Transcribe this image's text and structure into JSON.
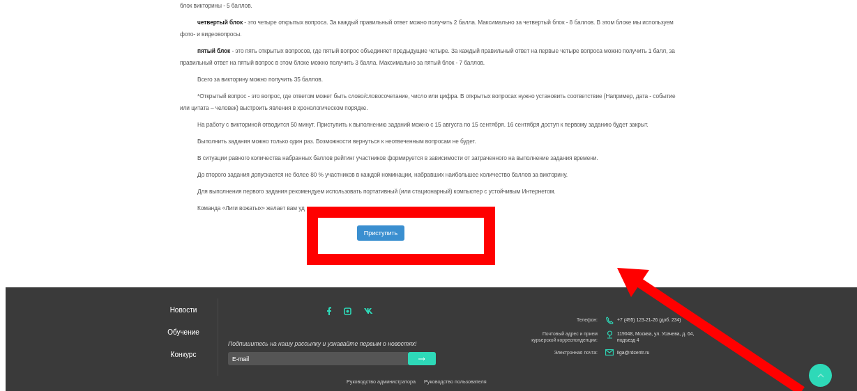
{
  "content": {
    "paragraphs": [
      {
        "text": "блок викторины - 5 баллов.",
        "indent": false
      },
      {
        "text": "**четвертый блок** - это четыре открытых вопроса. За каждый правильный ответ можно получить 2 балла. Максимально за четвертый блок - 8 баллов. В этом блоке мы используем фото- и видеовопросы.",
        "indent": true
      },
      {
        "text": "**пятый блок** - это пять открытых вопросов, где пятый вопрос объединяет предыдущие четыре. За каждый правильный ответ на первые четыре вопроса можно получить 1 балл, за правильный ответ на пятый вопрос в этом блоке можно получить 3 балла. Максимально за пятый блок - 7 баллов.",
        "indent": true
      },
      {
        "text": "Всего за викторину можно получить 35 баллов.",
        "indent": true
      },
      {
        "text": "*Открытый вопрос - это вопрос, где ответом может быть слово/словосочетание, число или цифра. В открытых вопросах нужно установить соответствие (Например, дата - событие или цитата – человек) выстроить явления в хронологическом порядке.",
        "indent": true
      },
      {
        "text": "На работу с викториной отводится 50 минут. Приступить к выполнению заданий можно с 15 августа по 15 сентября. 16 сентября доступ к первому заданию будет закрыт.",
        "indent": true
      },
      {
        "text": "Выполнить задания можно только один раз. Возможности вернуться к неотвеченным вопросам не будет.",
        "indent": true
      },
      {
        "text": "В ситуации равного количества набранных баллов рейтинг участников формируется в зависимости от затраченного на выполнение задания времени.",
        "indent": true
      },
      {
        "text": "До второго задания допускается не более 80 % участников в каждой номинации, набравших наибольшее количество баллов за викторину.",
        "indent": true
      },
      {
        "text": "Для выполнения первого задания рекомендуем использовать портативный (или стационарный) компьютер с устойчивым Интернетом.",
        "indent": true
      },
      {
        "text": "Команда «Лиги вожатых» желает вам уд",
        "indent": true
      }
    ],
    "start_button": {
      "label": "Приступить"
    }
  },
  "footer": {
    "nav": [
      {
        "label": "Новости"
      },
      {
        "label": "Обучение"
      },
      {
        "label": "Конкурс"
      }
    ],
    "social": [
      {
        "kind": "facebook"
      },
      {
        "kind": "instagram"
      },
      {
        "kind": "vk"
      }
    ],
    "subscribe": {
      "text": "Подпишитесь на нашу рассылку и узнавайте первым о новостях!",
      "placeholder": "E-mail"
    },
    "links": [
      "Руководство администратора",
      "Руководство пользователя"
    ],
    "contacts": [
      {
        "kind": "phone",
        "label": "Телефон:",
        "value": "+7 (495) 123-21-26 (доб. 234)"
      },
      {
        "kind": "address",
        "label": "Почтовый адрес и прием курьерской корреспонденции:",
        "value": "119048, Москва, ул. Усачева, д. 64, подъезд 4"
      },
      {
        "kind": "email",
        "label": "Электронная почта:",
        "value": "liga@rdcentr.ru"
      }
    ]
  },
  "annotations": {
    "frame": true,
    "arrow": true
  }
}
